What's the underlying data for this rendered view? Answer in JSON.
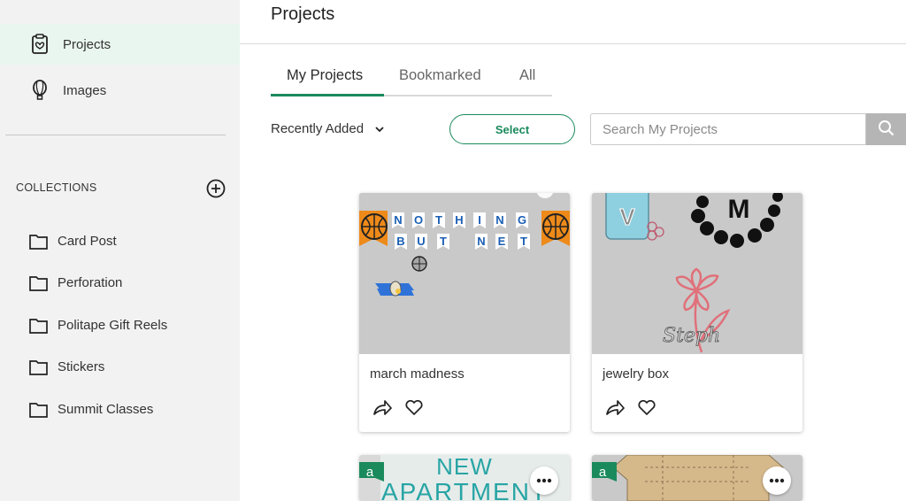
{
  "sidebar": {
    "nav": [
      {
        "label": "Projects",
        "icon": "projects-icon",
        "active": true
      },
      {
        "label": "Images",
        "icon": "balloon-icon",
        "active": false
      }
    ],
    "collections_title": "COLLECTIONS",
    "collections": [
      {
        "label": "Card Post",
        "icon": "folder-icon"
      },
      {
        "label": "Perforation",
        "icon": "folder-icon"
      },
      {
        "label": "Politape Gift Reels",
        "icon": "folder-icon"
      },
      {
        "label": "Stickers",
        "icon": "folder-icon"
      },
      {
        "label": "Summit Classes",
        "icon": "folder-icon"
      }
    ]
  },
  "header": {
    "title": "Projects"
  },
  "tabs": [
    {
      "label": "My Projects",
      "active": true
    },
    {
      "label": "Bookmarked",
      "active": false
    },
    {
      "label": "All",
      "active": false
    }
  ],
  "toolbar": {
    "sort_label": "Recently Added",
    "select_label": "Select",
    "search_placeholder": "Search My Projects"
  },
  "projects": [
    {
      "name": "march madness",
      "banner_top": "NOTHING",
      "banner_bottom": "BUT NET"
    },
    {
      "name": "jewelry box",
      "thumb_letter_left": "V",
      "thumb_letter_top": "M",
      "thumb_script": "Steph"
    }
  ],
  "more_projects": [
    {
      "thumb_text_1": "NEW",
      "thumb_text_2": "APARTMENT",
      "badge": "a"
    },
    {
      "badge": "a"
    }
  ],
  "colors": {
    "accent": "#1a8a5c",
    "sidebar_bg": "#f2f2f2",
    "active_nav_bg": "#e9f6ef"
  }
}
